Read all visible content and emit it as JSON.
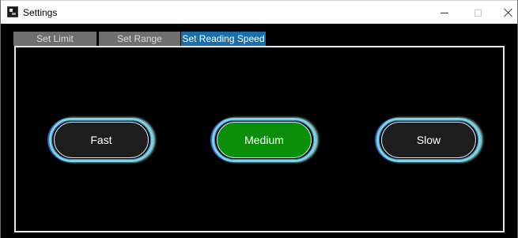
{
  "window": {
    "title": "Settings",
    "icon": "app-icon",
    "controls": [
      "minimize-icon",
      "maximize-icon",
      "close-icon"
    ]
  },
  "tabs": [
    {
      "label": "Set Limit",
      "selected": false
    },
    {
      "label": "Set Range",
      "selected": false
    },
    {
      "label": "Set Reading Speed",
      "selected": true
    }
  ],
  "speed_options": [
    {
      "label": "Fast",
      "selected": false
    },
    {
      "label": "Medium",
      "selected": true
    },
    {
      "label": "Slow",
      "selected": false
    }
  ],
  "colors": {
    "selected_tab": "#1b6fa8",
    "unselected_tab": "#6f6f6f",
    "selected_button": "#0a8f0a",
    "unselected_button": "#1e1e1e",
    "button_glow": "#7fd3e6",
    "background": "#000000"
  }
}
